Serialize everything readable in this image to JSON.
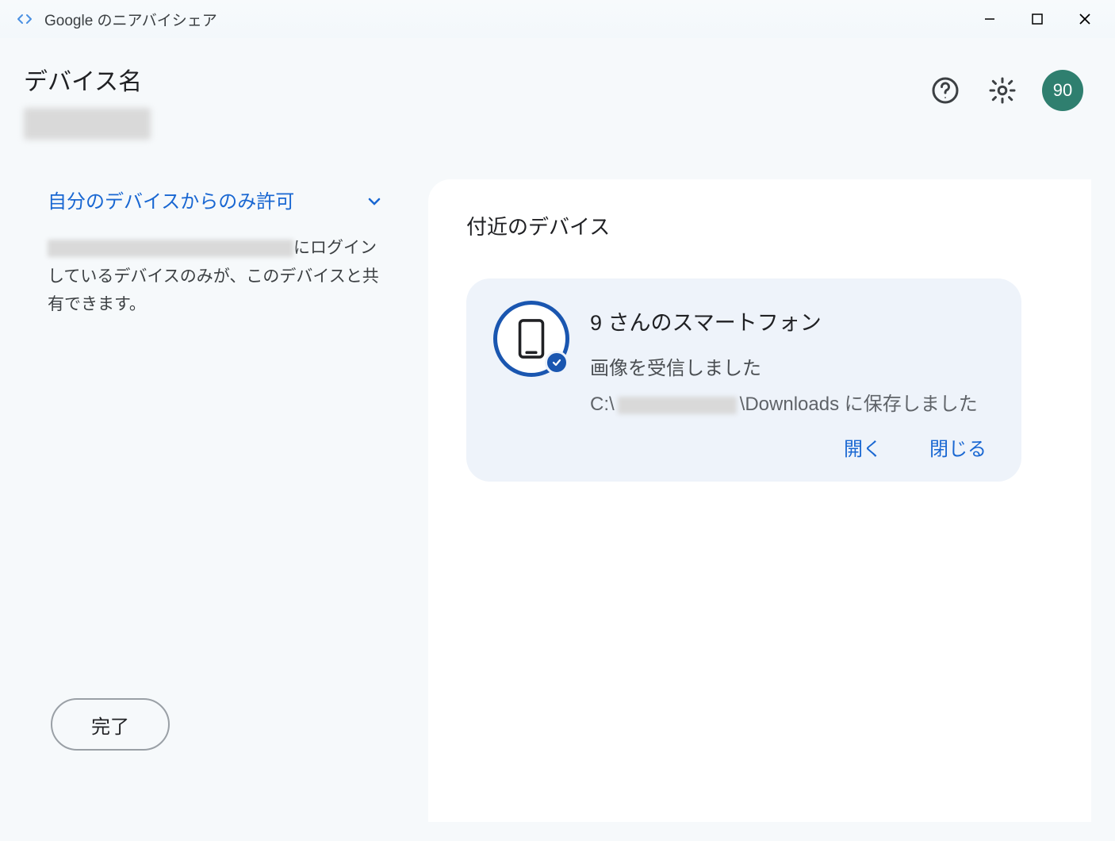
{
  "titlebar": {
    "title": "Google のニアバイシェア"
  },
  "header": {
    "deviceLabel": "デバイス名",
    "avatarText": "90"
  },
  "sidebar": {
    "visibilityLabel": "自分のデバイスからのみ許可",
    "descPart1": "にログインしているデバイスのみが、このデバイスと共有できます。",
    "doneLabel": "完了"
  },
  "main": {
    "heading": "付近のデバイス",
    "card": {
      "title": "9 さんのスマートフォン",
      "status": "画像を受信しました",
      "pathPrefix": "C:\\",
      "pathSuffix": "\\Downloads に保存しました",
      "openLabel": "開く",
      "closeLabel": "閉じる"
    }
  }
}
